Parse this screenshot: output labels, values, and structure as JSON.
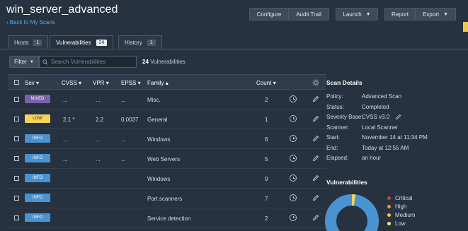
{
  "header": {
    "title": "win_server_advanced",
    "back_link": "Back to My Scans",
    "buttons": {
      "configure": "Configure",
      "audit_trail": "Audit Trail",
      "launch": "Launch",
      "report": "Report",
      "export": "Export"
    }
  },
  "tabs": [
    {
      "label": "Hosts",
      "count": "1"
    },
    {
      "label": "Vulnerabilities",
      "count": "24"
    },
    {
      "label": "History",
      "count": "1"
    }
  ],
  "filter": {
    "label": "Filter",
    "search_placeholder": "Search Vulnerabilities",
    "count_number": "24",
    "count_label": "Vulnerabilities"
  },
  "table": {
    "columns": {
      "sev": "Sev",
      "cvss": "CVSS",
      "vpr": "VPR",
      "epss": "EPSS",
      "family": "Family",
      "count": "Count"
    },
    "rows": [
      {
        "sev": "MIXED",
        "sev_class": "b-mixed",
        "cvss": "...",
        "vpr": "...",
        "epss": "...",
        "family": "Misc.",
        "count": "2"
      },
      {
        "sev": "LOW",
        "sev_class": "b-low",
        "cvss": "2.1 *",
        "vpr": "2.2",
        "epss": "0.0037",
        "family": "General",
        "count": "1"
      },
      {
        "sev": "INFO",
        "sev_class": "b-info",
        "cvss": "...",
        "vpr": "...",
        "epss": "...",
        "family": "Windows",
        "count": "6"
      },
      {
        "sev": "INFO",
        "sev_class": "b-info",
        "cvss": "...",
        "vpr": "...",
        "epss": "...",
        "family": "Web Servers",
        "count": "5"
      },
      {
        "sev": "INFO",
        "sev_class": "b-info",
        "cvss": "",
        "vpr": "",
        "epss": "",
        "family": "Windows",
        "count": "9"
      },
      {
        "sev": "INFO",
        "sev_class": "b-info",
        "cvss": "",
        "vpr": "",
        "epss": "",
        "family": "Port scanners",
        "count": "7"
      },
      {
        "sev": "INFO",
        "sev_class": "b-info",
        "cvss": "",
        "vpr": "",
        "epss": "",
        "family": "Service detection",
        "count": "2"
      }
    ]
  },
  "scan_details": {
    "heading": "Scan Details",
    "items": [
      {
        "label": "Policy:",
        "value": "Advanced Scan"
      },
      {
        "label": "Status:",
        "value": "Completed"
      },
      {
        "label": "Severity Base:",
        "value": "CVSS v3.0"
      },
      {
        "label": "Scanner:",
        "value": "Local Scanner"
      },
      {
        "label": "Start:",
        "value": "November 14 at 11:34 PM"
      },
      {
        "label": "End:",
        "value": "Today at 12:55 AM"
      },
      {
        "label": "Elapsed:",
        "value": "an hour"
      }
    ]
  },
  "vulnerabilities_panel": {
    "heading": "Vulnerabilities",
    "legend": [
      {
        "label": "Critical",
        "color": "#d43f3a"
      },
      {
        "label": "High",
        "color": "#ee9336"
      },
      {
        "label": "Medium",
        "color": "#fdc431"
      },
      {
        "label": "Low",
        "color": "#f6e36b"
      }
    ]
  },
  "colors": {
    "info": "#4a93d0",
    "low": "#f6d35a",
    "mixed": "#7a63a6",
    "accent_link": "#5aa7e0"
  }
}
